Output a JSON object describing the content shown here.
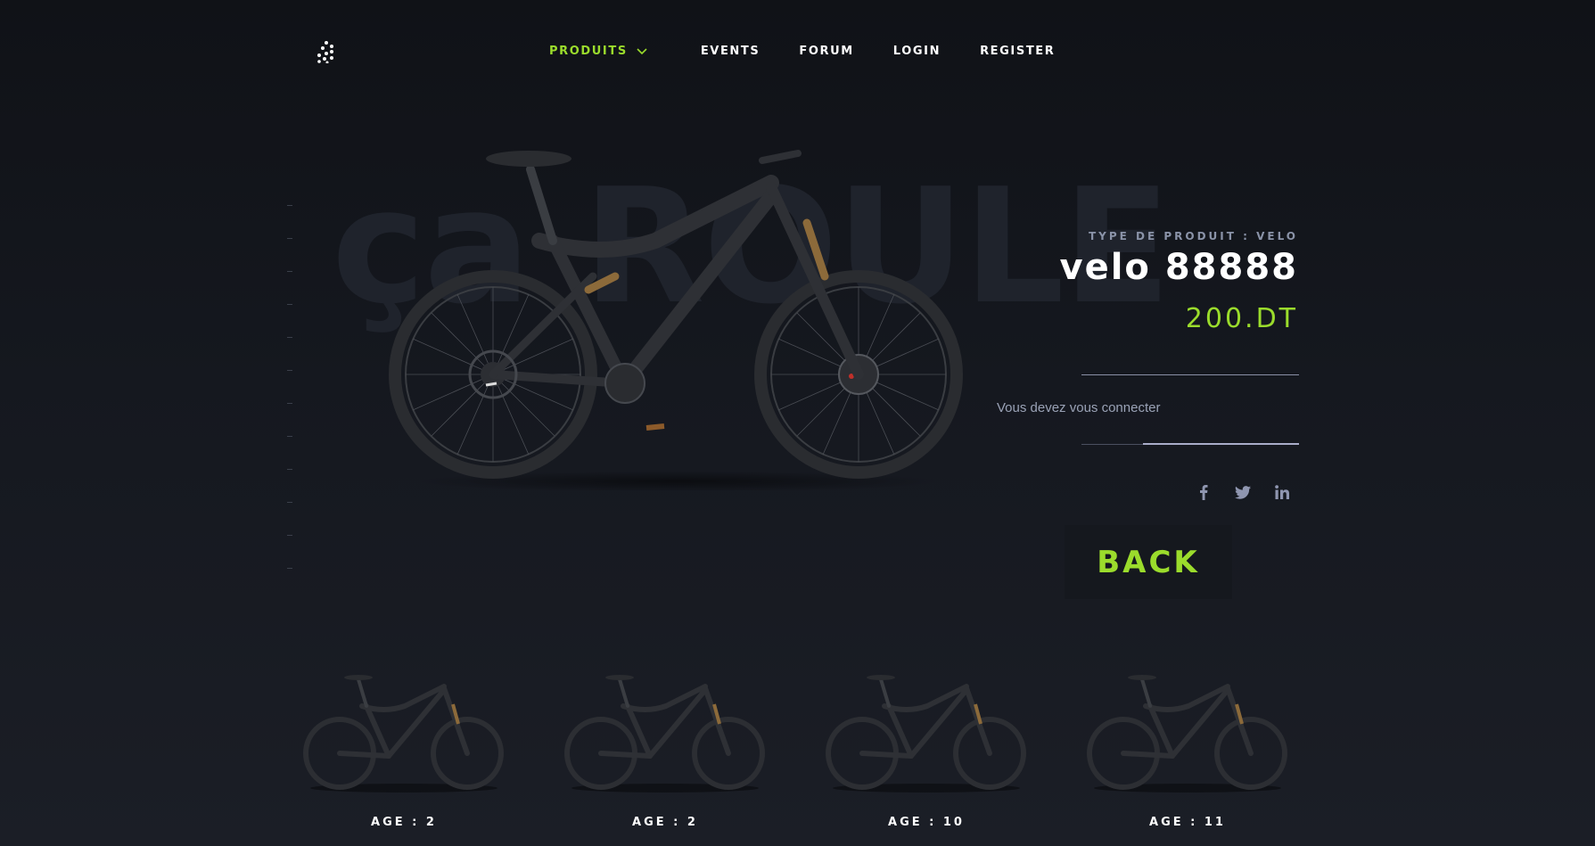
{
  "nav": {
    "logo_icon": "dots-logo-icon",
    "items": [
      {
        "label": "PRODUITS",
        "active": true,
        "has_dropdown": true
      },
      {
        "label": "EVENTS"
      },
      {
        "label": "FORUM"
      },
      {
        "label": "LOGIN"
      },
      {
        "label": "REGISTER"
      }
    ]
  },
  "hero": {
    "background_word": "ça ROULE"
  },
  "product": {
    "type_label": "TYPE DE PRODUIT : VELO",
    "name": "velo 88888",
    "price": "200.DT",
    "login_message": "Vous devez vous connecter"
  },
  "socials": [
    {
      "icon": "facebook-icon"
    },
    {
      "icon": "twitter-icon"
    },
    {
      "icon": "linkedin-icon"
    }
  ],
  "back_label": "BACK",
  "related": [
    {
      "label": "AGE : 2"
    },
    {
      "label": "AGE : 2"
    },
    {
      "label": "AGE : 10"
    },
    {
      "label": "AGE : 11"
    }
  ],
  "colors": {
    "accent": "#9bdc2c",
    "background": "#15181f",
    "muted_text": "#8a93a8"
  }
}
